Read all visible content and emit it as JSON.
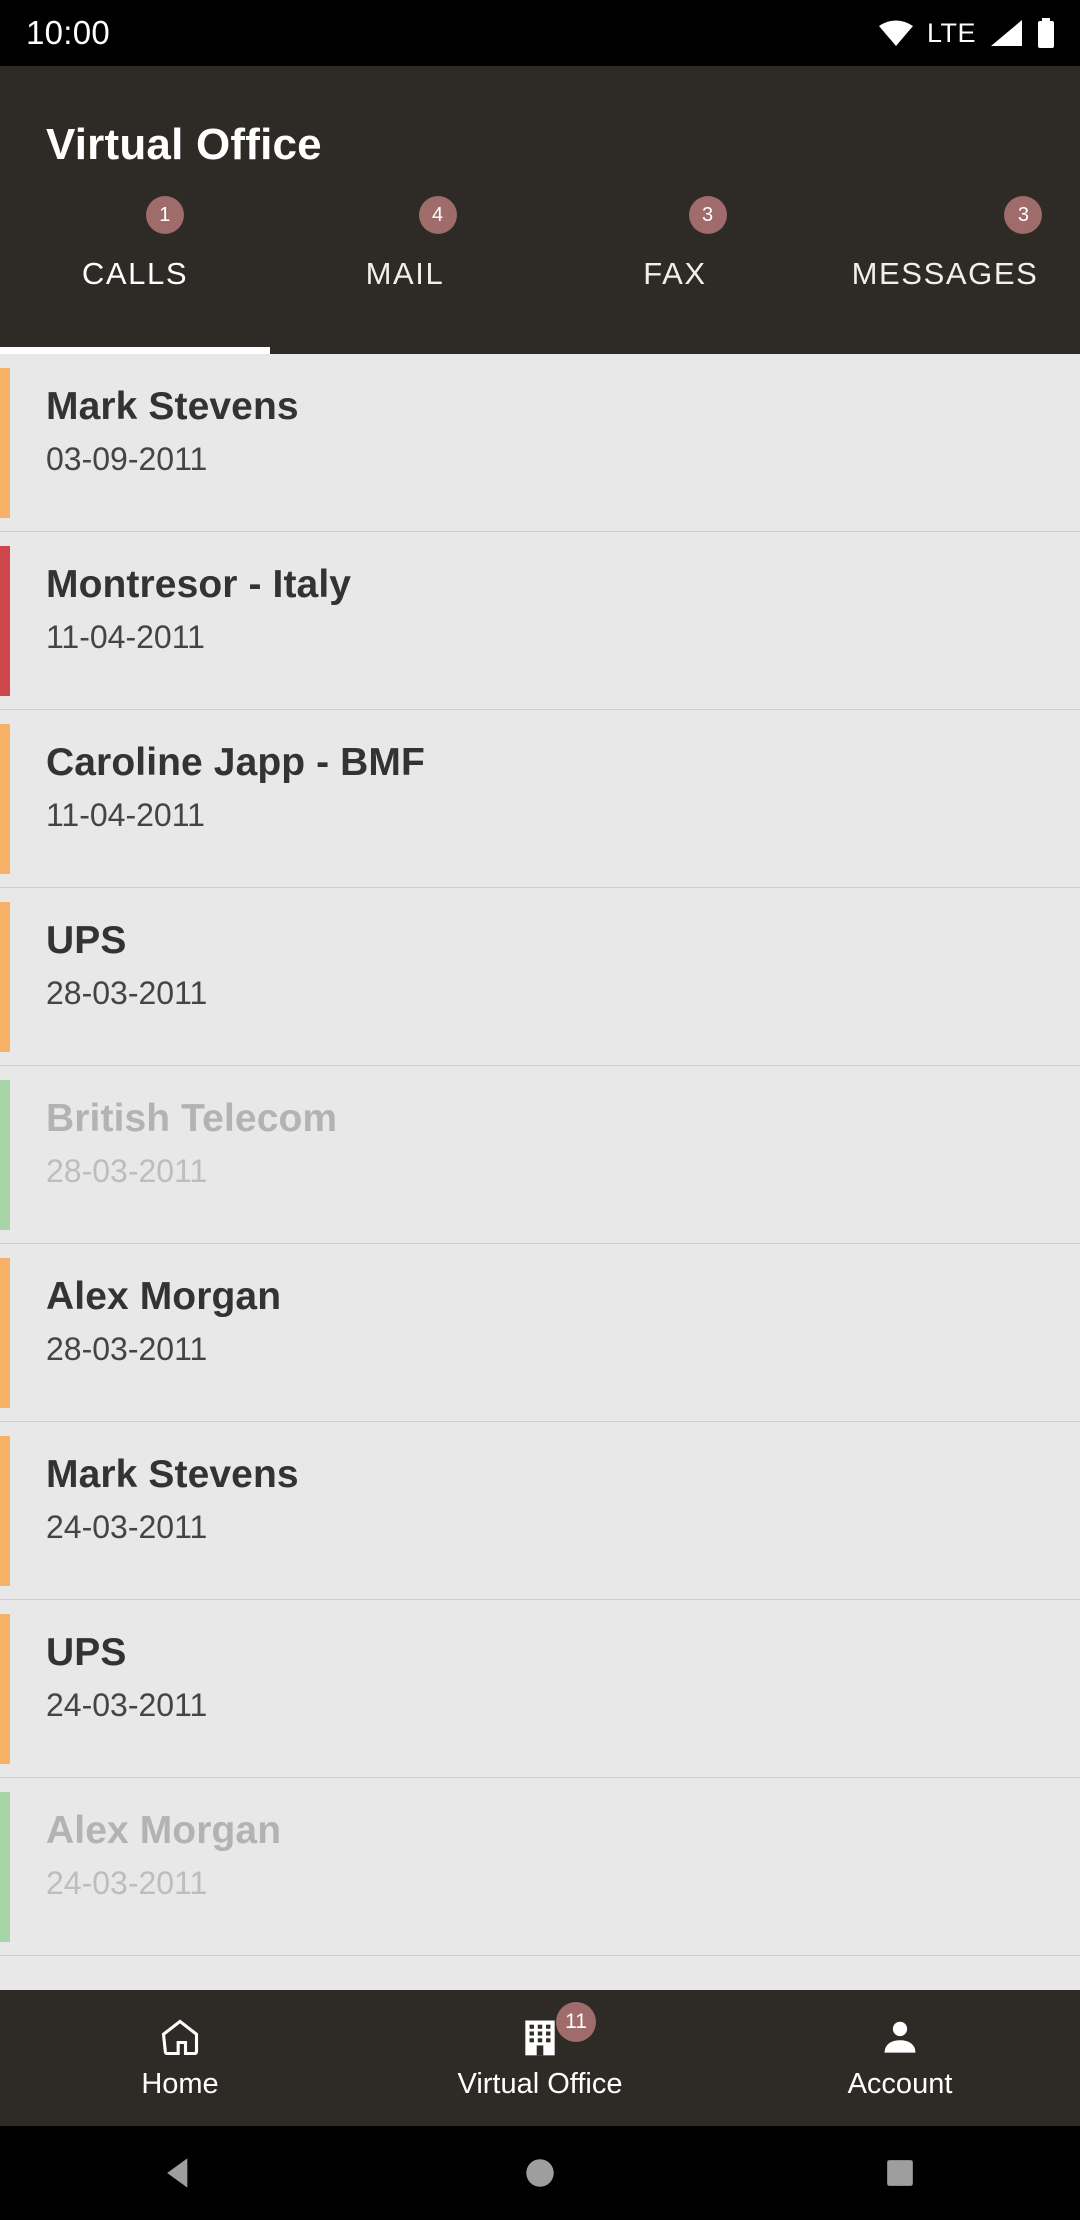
{
  "status_bar": {
    "clock": "10:00",
    "network_label": "LTE",
    "icons": [
      "wifi-icon",
      "lte-label",
      "signal-icon",
      "battery-icon"
    ]
  },
  "app_bar": {
    "title": "Virtual Office"
  },
  "tabs": [
    {
      "label": "CALLS",
      "badge": "1",
      "active": true
    },
    {
      "label": "MAIL",
      "badge": "4",
      "active": false
    },
    {
      "label": "FAX",
      "badge": "3",
      "active": false
    },
    {
      "label": "MESSAGES",
      "badge": "3",
      "active": false
    }
  ],
  "colors": {
    "accent_orange": "#f5b166",
    "accent_red": "#d0474b",
    "accent_green": "#a8d5a8",
    "badge_bg": "#9f6b6b",
    "appbar_bg": "#2e2a26",
    "list_bg": "#e8e8e8"
  },
  "list_items": [
    {
      "title": "Mark Stevens",
      "date": "03-09-2011",
      "bar": "#f5b166",
      "read": false
    },
    {
      "title": "Montresor  - Italy",
      "date": "11-04-2011",
      "bar": "#d0474b",
      "read": false
    },
    {
      "title": "Caroline Japp - BMF",
      "date": "11-04-2011",
      "bar": "#f5b166",
      "read": false
    },
    {
      "title": "UPS",
      "date": "28-03-2011",
      "bar": "#f5b166",
      "read": false
    },
    {
      "title": "British Telecom",
      "date": "28-03-2011",
      "bar": "#a8d5a8",
      "read": true
    },
    {
      "title": "Alex Morgan",
      "date": "28-03-2011",
      "bar": "#f5b166",
      "read": false
    },
    {
      "title": "Mark Stevens",
      "date": "24-03-2011",
      "bar": "#f5b166",
      "read": false
    },
    {
      "title": "UPS",
      "date": "24-03-2011",
      "bar": "#f5b166",
      "read": false
    },
    {
      "title": "Alex Morgan",
      "date": "24-03-2011",
      "bar": "#a8d5a8",
      "read": true
    }
  ],
  "bottom_nav": [
    {
      "label": "Home",
      "icon": "home-icon",
      "badge": null
    },
    {
      "label": "Virtual Office",
      "icon": "office-icon",
      "badge": "11"
    },
    {
      "label": "Account",
      "icon": "person-icon",
      "badge": null
    }
  ],
  "system_nav": [
    {
      "icon": "back-triangle-icon"
    },
    {
      "icon": "home-circle-icon"
    },
    {
      "icon": "recents-square-icon"
    }
  ]
}
